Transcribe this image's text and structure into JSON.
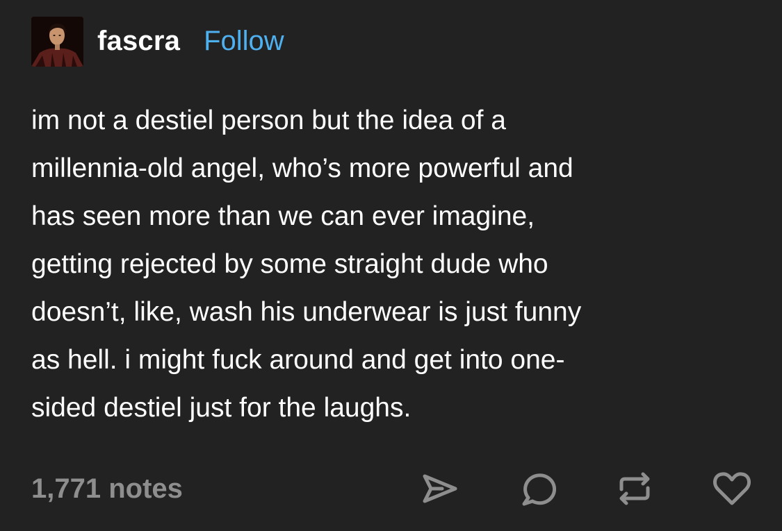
{
  "post": {
    "username": "fascra",
    "follow_label": "Follow",
    "avatar_icon": "user-avatar-photo",
    "body_lines": [
      "im not a destiel person but the idea of a",
      "millennia-old angel, who’s more powerful and",
      "has seen more than we can ever imagine,",
      "getting rejected by some straight dude who",
      "doesn’t, like, wash his underwear is just funny",
      "as hell. i might fuck around and get into one-",
      "sided destiel just for the laughs."
    ],
    "notes_label": "1,771 notes"
  },
  "actions": {
    "share_icon": "share-icon",
    "reply_icon": "reply-icon",
    "reblog_icon": "reblog-icon",
    "like_icon": "like-heart-icon"
  },
  "colors": {
    "background": "#222222",
    "text": "#ffffff",
    "follow": "#4fb0ef",
    "muted": "#8e8e8e"
  }
}
